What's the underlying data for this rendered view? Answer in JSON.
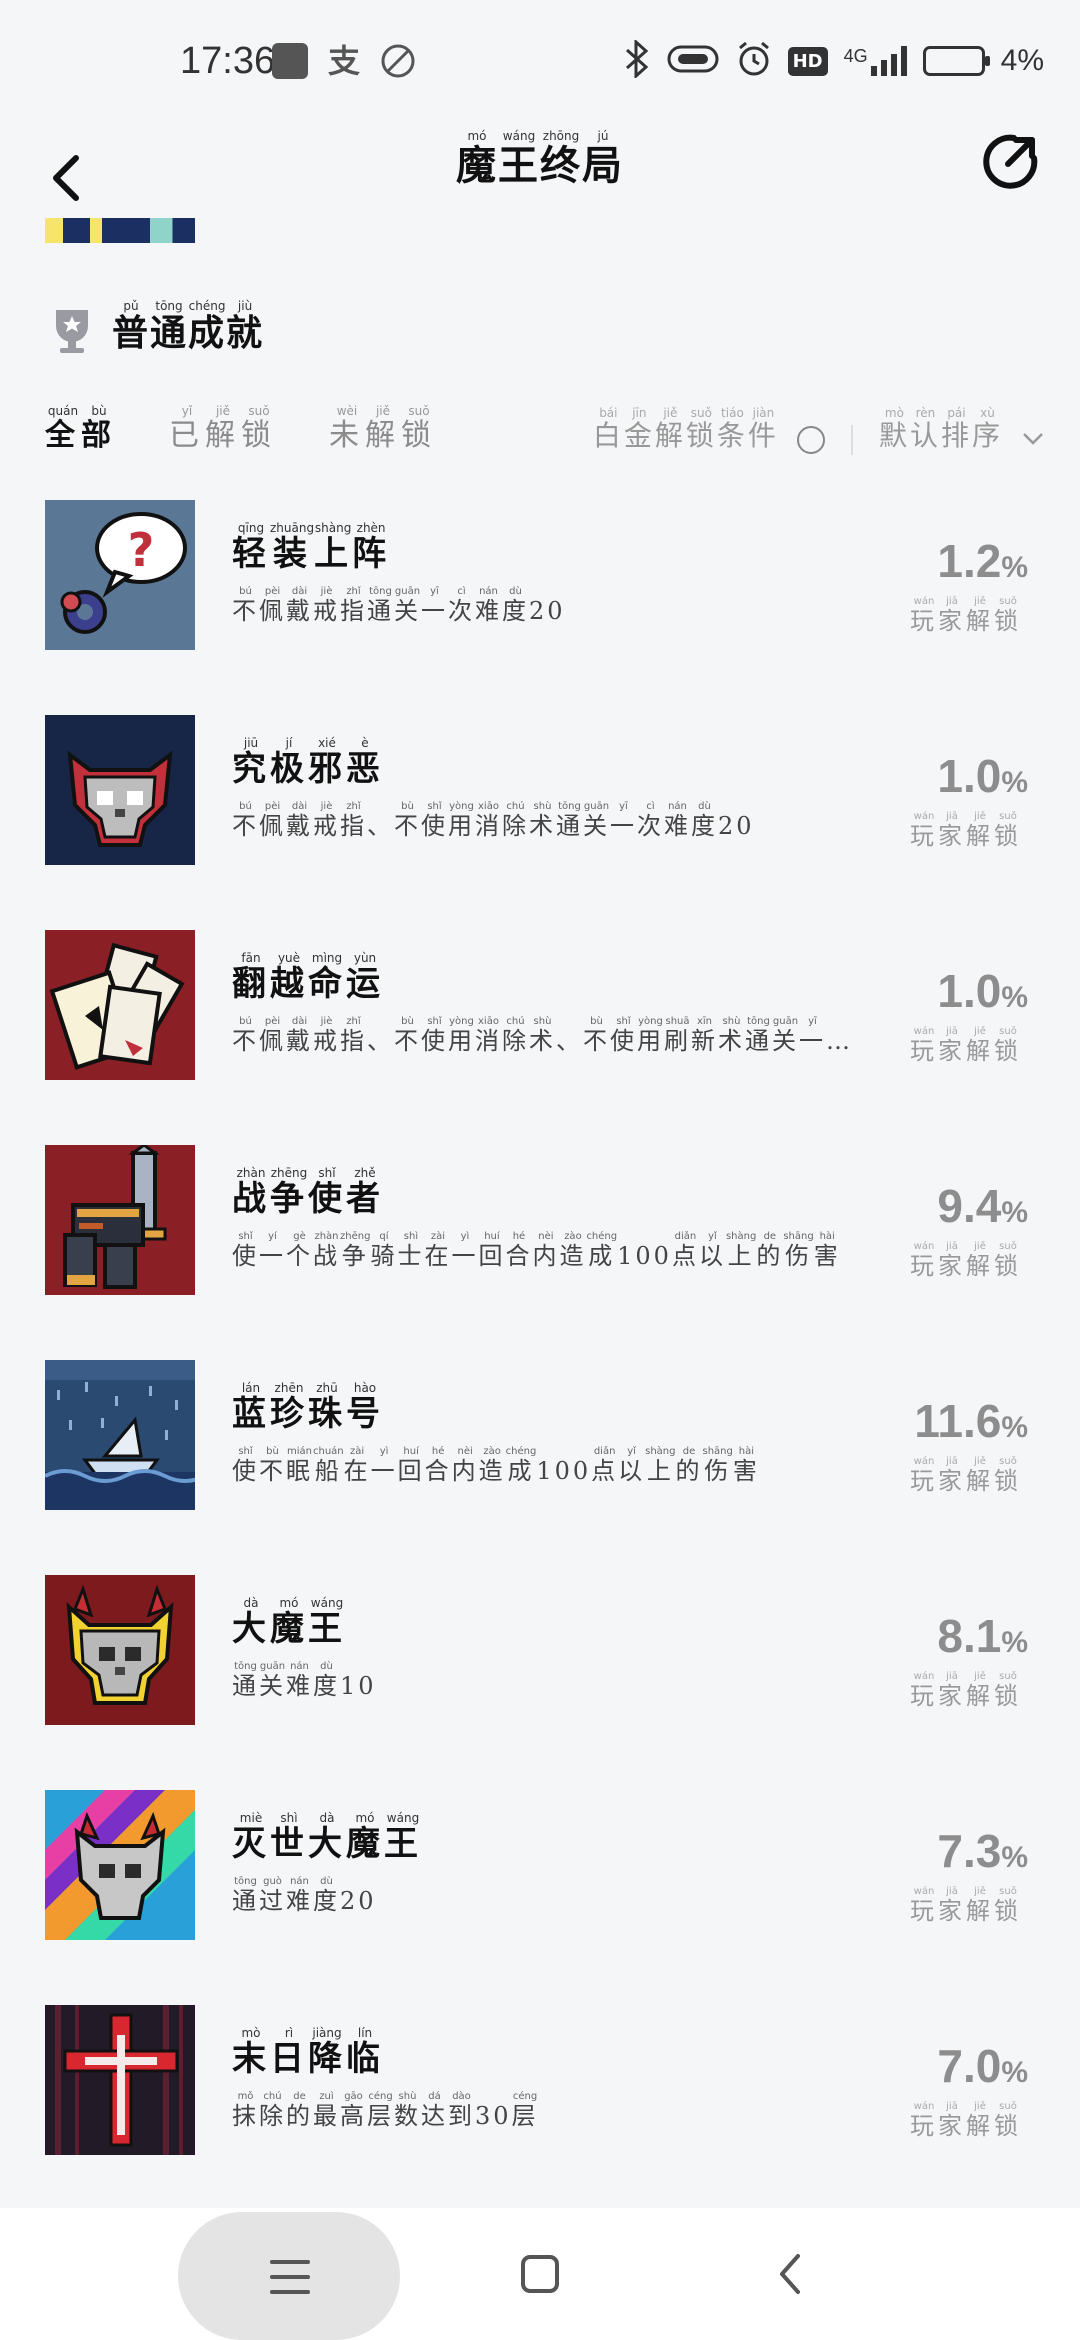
{
  "status_bar": {
    "time": "17:36",
    "network": "4G",
    "hd": "HD",
    "battery_percent": "4%"
  },
  "header": {
    "title": [
      {
        "ch": "魔",
        "py": "mó"
      },
      {
        "ch": "王",
        "py": "wáng"
      },
      {
        "ch": "终",
        "py": "zhōng"
      },
      {
        "ch": "局",
        "py": "jú"
      }
    ]
  },
  "section": {
    "title": [
      {
        "ch": "普",
        "py": "pǔ"
      },
      {
        "ch": "通",
        "py": "tōng"
      },
      {
        "ch": "成",
        "py": "chéng"
      },
      {
        "ch": "就",
        "py": "jiù"
      }
    ]
  },
  "filters": {
    "tabs": [
      {
        "text": [
          {
            "ch": "全",
            "py": "quán"
          },
          {
            "ch": "部",
            "py": "bù"
          }
        ],
        "active": true
      },
      {
        "text": [
          {
            "ch": "已",
            "py": "yǐ"
          },
          {
            "ch": "解",
            "py": "jiě"
          },
          {
            "ch": "锁",
            "py": "suǒ"
          }
        ],
        "active": false
      },
      {
        "text": [
          {
            "ch": "未",
            "py": "wèi"
          },
          {
            "ch": "解",
            "py": "jiě"
          },
          {
            "ch": "锁",
            "py": "suǒ"
          }
        ],
        "active": false
      }
    ],
    "platinum_condition": [
      {
        "ch": "白",
        "py": "bái"
      },
      {
        "ch": "金",
        "py": "jīn"
      },
      {
        "ch": "解",
        "py": "jiě"
      },
      {
        "ch": "锁",
        "py": "suǒ"
      },
      {
        "ch": "条",
        "py": "tiáo"
      },
      {
        "ch": "件",
        "py": "jiàn"
      }
    ],
    "sort": [
      {
        "ch": "默",
        "py": "mò"
      },
      {
        "ch": "认",
        "py": "rèn"
      },
      {
        "ch": "排",
        "py": "pái"
      },
      {
        "ch": "序",
        "py": "xù"
      }
    ]
  },
  "unlock_label": [
    {
      "ch": "玩",
      "py": "wán"
    },
    {
      "ch": "家",
      "py": "jiā"
    },
    {
      "ch": "解",
      "py": "jiě"
    },
    {
      "ch": "锁",
      "py": "suǒ"
    }
  ],
  "achievements": [
    {
      "icon": "ring-question-icon",
      "name": [
        {
          "ch": "轻",
          "py": "qīng"
        },
        {
          "ch": "装",
          "py": "zhuāng"
        },
        {
          "ch": "上",
          "py": "shàng"
        },
        {
          "ch": "阵",
          "py": "zhèn"
        }
      ],
      "desc": [
        {
          "ch": "不",
          "py": "bú"
        },
        {
          "ch": "佩",
          "py": "pèi"
        },
        {
          "ch": "戴",
          "py": "dài"
        },
        {
          "ch": "戒",
          "py": "jiè"
        },
        {
          "ch": "指",
          "py": "zhǐ"
        },
        {
          "ch": "通",
          "py": "tōng"
        },
        {
          "ch": "关",
          "py": "guān"
        },
        {
          "ch": "一",
          "py": "yī"
        },
        {
          "ch": "次",
          "py": "cì"
        },
        {
          "ch": "难",
          "py": "nán"
        },
        {
          "ch": "度",
          "py": "dù"
        },
        {
          "ch": "20",
          "py": ""
        }
      ],
      "percent": "1.2"
    },
    {
      "icon": "evil-skull-icon",
      "name": [
        {
          "ch": "究",
          "py": "jiū"
        },
        {
          "ch": "极",
          "py": "jí"
        },
        {
          "ch": "邪",
          "py": "xié"
        },
        {
          "ch": "恶",
          "py": "è"
        }
      ],
      "desc": [
        {
          "ch": "不",
          "py": "bú"
        },
        {
          "ch": "佩",
          "py": "pèi"
        },
        {
          "ch": "戴",
          "py": "dài"
        },
        {
          "ch": "戒",
          "py": "jiè"
        },
        {
          "ch": "指",
          "py": "zhǐ"
        },
        {
          "ch": "、",
          "py": ""
        },
        {
          "ch": "不",
          "py": "bù"
        },
        {
          "ch": "使",
          "py": "shǐ"
        },
        {
          "ch": "用",
          "py": "yòng"
        },
        {
          "ch": "消",
          "py": "xiāo"
        },
        {
          "ch": "除",
          "py": "chú"
        },
        {
          "ch": "术",
          "py": "shù"
        },
        {
          "ch": "通",
          "py": "tōng"
        },
        {
          "ch": "关",
          "py": "guān"
        },
        {
          "ch": "一",
          "py": "yī"
        },
        {
          "ch": "次",
          "py": "cì"
        },
        {
          "ch": "难",
          "py": "nán"
        },
        {
          "ch": "度",
          "py": "dù"
        },
        {
          "ch": "20",
          "py": ""
        }
      ],
      "percent": "1.0"
    },
    {
      "icon": "cards-icon",
      "name": [
        {
          "ch": "翻",
          "py": "fān"
        },
        {
          "ch": "越",
          "py": "yuè"
        },
        {
          "ch": "命",
          "py": "mìng"
        },
        {
          "ch": "运",
          "py": "yùn"
        }
      ],
      "desc": [
        {
          "ch": "不",
          "py": "bú"
        },
        {
          "ch": "佩",
          "py": "pèi"
        },
        {
          "ch": "戴",
          "py": "dài"
        },
        {
          "ch": "戒",
          "py": "jiè"
        },
        {
          "ch": "指",
          "py": "zhǐ"
        },
        {
          "ch": "、",
          "py": ""
        },
        {
          "ch": "不",
          "py": "bù"
        },
        {
          "ch": "使",
          "py": "shǐ"
        },
        {
          "ch": "用",
          "py": "yòng"
        },
        {
          "ch": "消",
          "py": "xiāo"
        },
        {
          "ch": "除",
          "py": "chú"
        },
        {
          "ch": "术",
          "py": "shù"
        },
        {
          "ch": "、",
          "py": ""
        },
        {
          "ch": "不",
          "py": "bù"
        },
        {
          "ch": "使",
          "py": "shǐ"
        },
        {
          "ch": "用",
          "py": "yòng"
        },
        {
          "ch": "刷",
          "py": "shuā"
        },
        {
          "ch": "新",
          "py": "xīn"
        },
        {
          "ch": "术",
          "py": "shù"
        },
        {
          "ch": "通",
          "py": "tōng"
        },
        {
          "ch": "关",
          "py": "guān"
        },
        {
          "ch": "一",
          "py": "yī"
        },
        {
          "ch": "…",
          "py": ""
        }
      ],
      "percent": "1.0"
    },
    {
      "icon": "knight-sword-icon",
      "name": [
        {
          "ch": "战",
          "py": "zhàn"
        },
        {
          "ch": "争",
          "py": "zhēng"
        },
        {
          "ch": "使",
          "py": "shǐ"
        },
        {
          "ch": "者",
          "py": "zhě"
        }
      ],
      "desc": [
        {
          "ch": "使",
          "py": "shǐ"
        },
        {
          "ch": "一",
          "py": "yí"
        },
        {
          "ch": "个",
          "py": "gè"
        },
        {
          "ch": "战",
          "py": "zhàn"
        },
        {
          "ch": "争",
          "py": "zhēng"
        },
        {
          "ch": "骑",
          "py": "qí"
        },
        {
          "ch": "士",
          "py": "shì"
        },
        {
          "ch": "在",
          "py": "zài"
        },
        {
          "ch": "一",
          "py": "yì"
        },
        {
          "ch": "回",
          "py": "huí"
        },
        {
          "ch": "合",
          "py": "hé"
        },
        {
          "ch": "内",
          "py": "nèi"
        },
        {
          "ch": "造",
          "py": "zào"
        },
        {
          "ch": "成",
          "py": "chéng"
        },
        {
          "ch": "100",
          "py": ""
        },
        {
          "ch": "点",
          "py": "diǎn"
        },
        {
          "ch": "以",
          "py": "yǐ"
        },
        {
          "ch": "上",
          "py": "shàng"
        },
        {
          "ch": "的",
          "py": "de"
        },
        {
          "ch": "伤",
          "py": "shāng"
        },
        {
          "ch": "害",
          "py": "hài"
        }
      ],
      "percent": "9.4"
    },
    {
      "icon": "ship-rain-icon",
      "name": [
        {
          "ch": "蓝",
          "py": "lán"
        },
        {
          "ch": "珍",
          "py": "zhēn"
        },
        {
          "ch": "珠",
          "py": "zhū"
        },
        {
          "ch": "号",
          "py": "hào"
        }
      ],
      "desc": [
        {
          "ch": "使",
          "py": "shǐ"
        },
        {
          "ch": "不",
          "py": "bù"
        },
        {
          "ch": "眠",
          "py": "mián"
        },
        {
          "ch": "船",
          "py": "chuán"
        },
        {
          "ch": "在",
          "py": "zài"
        },
        {
          "ch": "一",
          "py": "yì"
        },
        {
          "ch": "回",
          "py": "huí"
        },
        {
          "ch": "合",
          "py": "hé"
        },
        {
          "ch": "内",
          "py": "nèi"
        },
        {
          "ch": "造",
          "py": "zào"
        },
        {
          "ch": "成",
          "py": "chéng"
        },
        {
          "ch": "100",
          "py": ""
        },
        {
          "ch": "点",
          "py": "diǎn"
        },
        {
          "ch": "以",
          "py": "yǐ"
        },
        {
          "ch": "上",
          "py": "shàng"
        },
        {
          "ch": "的",
          "py": "de"
        },
        {
          "ch": "伤",
          "py": "shāng"
        },
        {
          "ch": "害",
          "py": "hài"
        }
      ],
      "percent": "11.6"
    },
    {
      "icon": "demon-skull-icon",
      "name": [
        {
          "ch": "大",
          "py": "dà"
        },
        {
          "ch": "魔",
          "py": "mó"
        },
        {
          "ch": "王",
          "py": "wáng"
        }
      ],
      "desc": [
        {
          "ch": "通",
          "py": "tōng"
        },
        {
          "ch": "关",
          "py": "guān"
        },
        {
          "ch": "难",
          "py": "nán"
        },
        {
          "ch": "度",
          "py": "dù"
        },
        {
          "ch": "10",
          "py": ""
        }
      ],
      "percent": "8.1"
    },
    {
      "icon": "rainbow-skull-icon",
      "name": [
        {
          "ch": "灭",
          "py": "miè"
        },
        {
          "ch": "世",
          "py": "shì"
        },
        {
          "ch": "大",
          "py": "dà"
        },
        {
          "ch": "魔",
          "py": "mó"
        },
        {
          "ch": "王",
          "py": "wáng"
        }
      ],
      "desc": [
        {
          "ch": "通",
          "py": "tōng"
        },
        {
          "ch": "过",
          "py": "guò"
        },
        {
          "ch": "难",
          "py": "nán"
        },
        {
          "ch": "度",
          "py": "dù"
        },
        {
          "ch": "20",
          "py": ""
        }
      ],
      "percent": "7.3"
    },
    {
      "icon": "dark-cross-icon",
      "name": [
        {
          "ch": "末",
          "py": "mò"
        },
        {
          "ch": "日",
          "py": "rì"
        },
        {
          "ch": "降",
          "py": "jiàng"
        },
        {
          "ch": "临",
          "py": "lín"
        }
      ],
      "desc": [
        {
          "ch": "抹",
          "py": "mǒ"
        },
        {
          "ch": "除",
          "py": "chú"
        },
        {
          "ch": "的",
          "py": "de"
        },
        {
          "ch": "最",
          "py": "zuì"
        },
        {
          "ch": "高",
          "py": "gāo"
        },
        {
          "ch": "层",
          "py": "céng"
        },
        {
          "ch": "数",
          "py": "shù"
        },
        {
          "ch": "达",
          "py": "dá"
        },
        {
          "ch": "到",
          "py": "dào"
        },
        {
          "ch": "30",
          "py": ""
        },
        {
          "ch": "层",
          "py": "céng"
        }
      ],
      "percent": "7.0"
    }
  ],
  "percent_symbol": "%",
  "colors": {
    "background": "#f5f6f8",
    "percent_text": "#8d8d8d",
    "nav_pill": "#e4e4e4"
  }
}
